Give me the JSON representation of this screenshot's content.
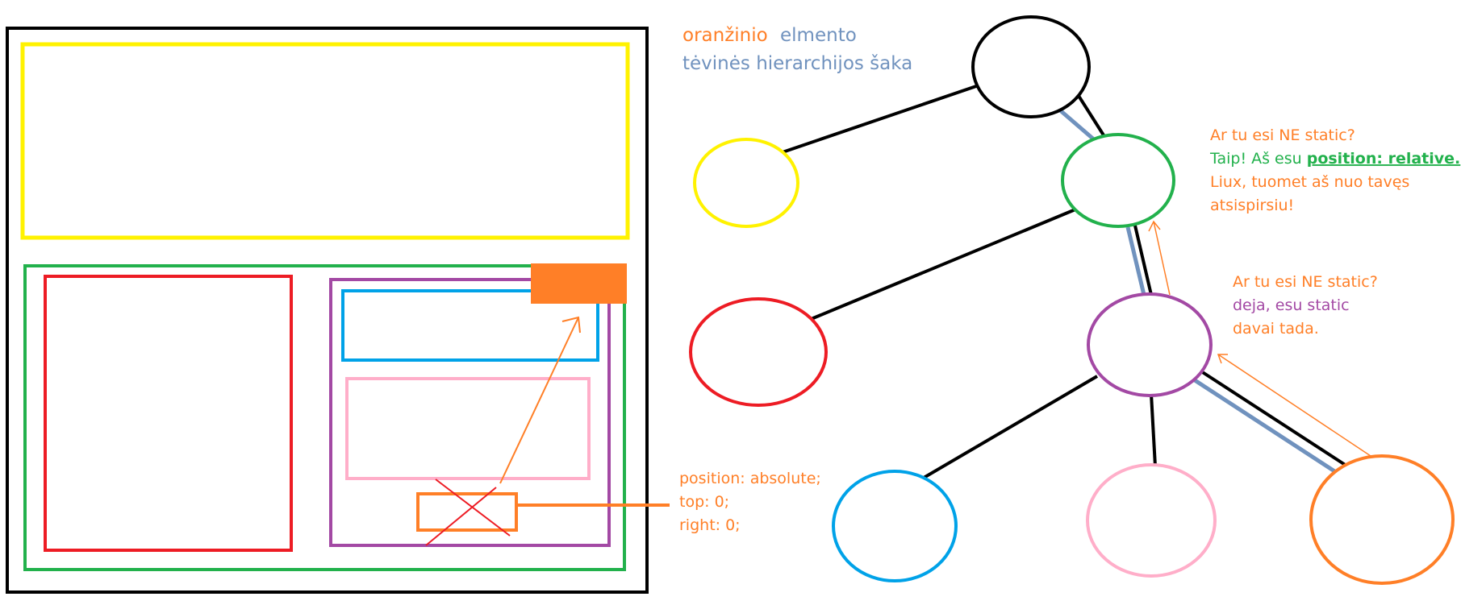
{
  "legend": {
    "line1_word1": "oranžinio",
    "line1_word2": "elmento",
    "line2": "tėvinės hierarchijos šaka"
  },
  "css_note": {
    "line1": "position: absolute;",
    "line2": "top: 0;",
    "line3": "right: 0;"
  },
  "purple_dialog": {
    "question": "Ar tu esi NE static?",
    "answer": "deja, esu static",
    "reply": "davai tada."
  },
  "green_dialog": {
    "question": "Ar tu esi NE static?",
    "answer_prefix": "Taip! Aš esu ",
    "answer_bold": "position: relative.",
    "reply_line1": "Liux, tuomet aš nuo tavęs",
    "reply_line2": "atsispirsiu!"
  },
  "colors": {
    "black": "#000000",
    "yellow": "#fff200",
    "green": "#22b14c",
    "red": "#ed1c24",
    "purple": "#a349a4",
    "blue": "#00a2e8",
    "pink": "#ffaec9",
    "orange": "#ff7f27",
    "branch_blue": "#7092be"
  }
}
